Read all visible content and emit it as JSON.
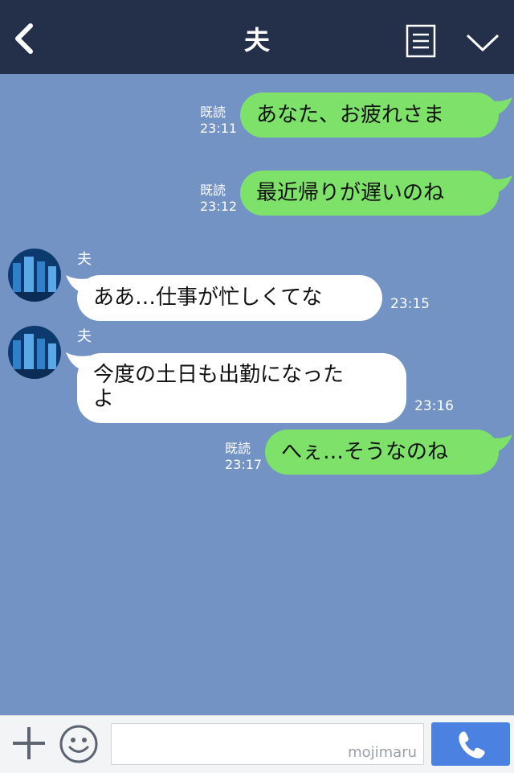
{
  "header": {
    "title": "夫",
    "back_icon": "chevron-left-icon",
    "menu_icon": "note-icon",
    "more_icon": "chevron-down-icon"
  },
  "messages": [
    {
      "side": "mine",
      "text": "あなた、お疲れさま",
      "read": "既読",
      "time": "23:11"
    },
    {
      "side": "mine",
      "text": "最近帰りが遅いのね",
      "read": "既読",
      "time": "23:12"
    },
    {
      "side": "theirs",
      "sender": "夫",
      "text": "ああ…仕事が忙しくてな",
      "time": "23:15"
    },
    {
      "side": "theirs",
      "sender": "夫",
      "text_line1": "今度の土日も出勤になった",
      "text_line2": "よ",
      "time": "23:16"
    },
    {
      "side": "mine",
      "text": "へぇ…そうなのね",
      "read": "既読",
      "time": "23:17"
    }
  ],
  "composer": {
    "placeholder": "",
    "watermark": "mojimaru",
    "plus_icon": "plus-icon",
    "emoji_icon": "smiley-icon",
    "call_icon": "phone-icon"
  },
  "colors": {
    "header_bg": "#243049",
    "chat_bg": "#7393c4",
    "my_bubble": "#7ee16a",
    "their_bubble": "#ffffff",
    "call_button": "#4b82e1"
  }
}
